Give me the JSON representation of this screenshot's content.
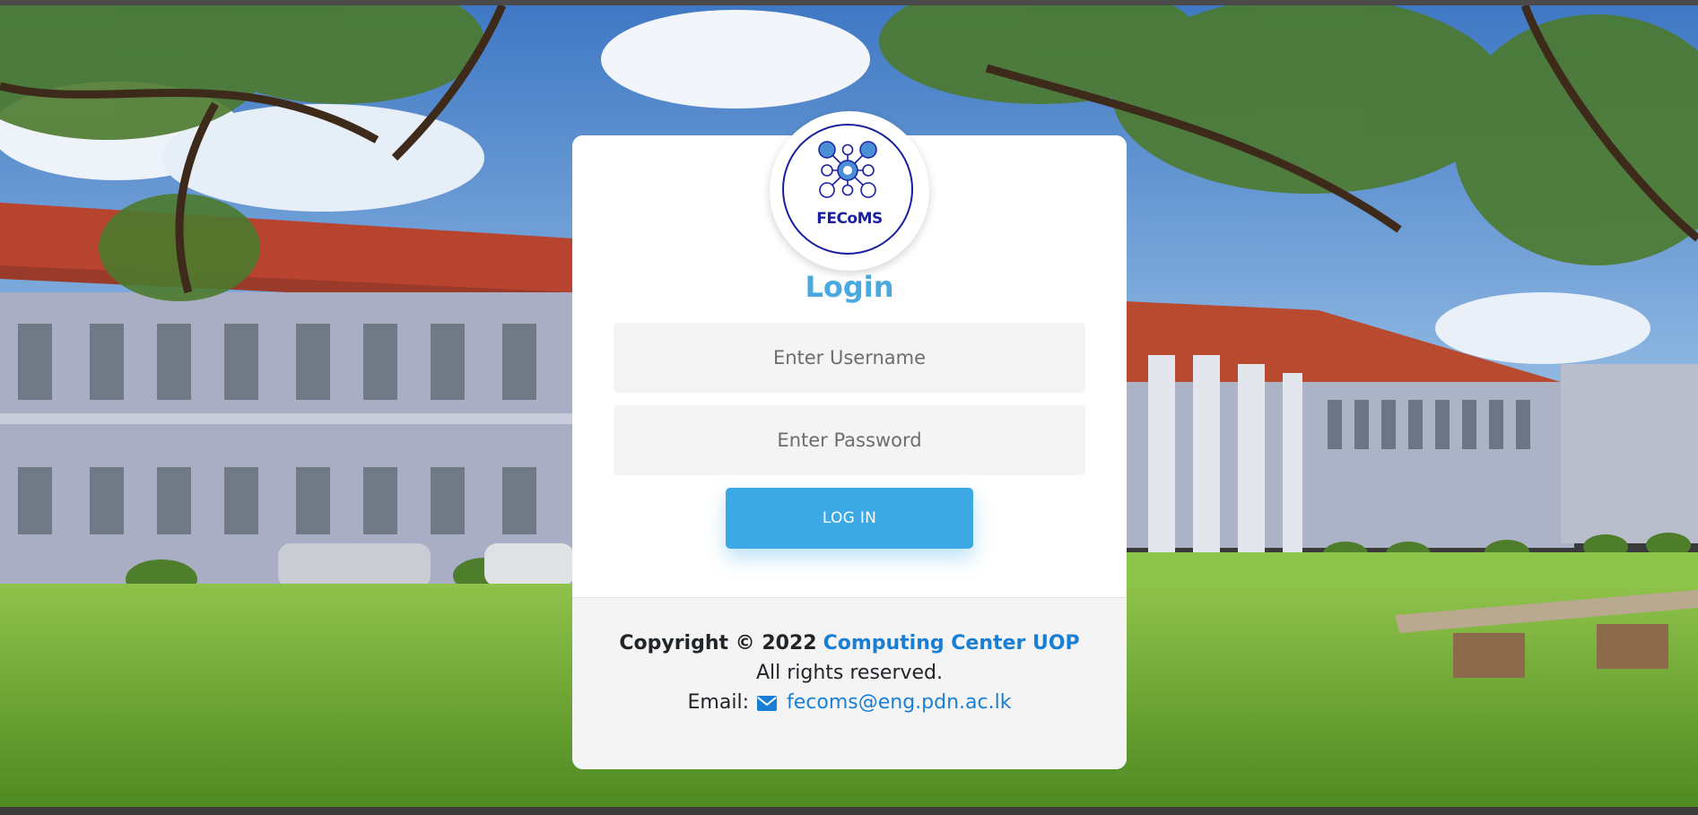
{
  "brand": {
    "logo_text": "FECoMS",
    "colors": {
      "logo": "#1a1f9e",
      "accent": "#3ca9e5",
      "title": "#4aa9df",
      "link": "#1a7fd4"
    }
  },
  "login": {
    "title": "Login",
    "username_placeholder": "Enter Username",
    "password_placeholder": "Enter Password",
    "button_label": "LOG IN"
  },
  "footer": {
    "copyright_prefix": "Copyright © 2022",
    "org_link": "Computing Center UOP",
    "rights": "All rights reserved.",
    "email_label": "Email:",
    "email_icon": "envelope-icon",
    "email": "fecoms@eng.pdn.ac.lk"
  }
}
